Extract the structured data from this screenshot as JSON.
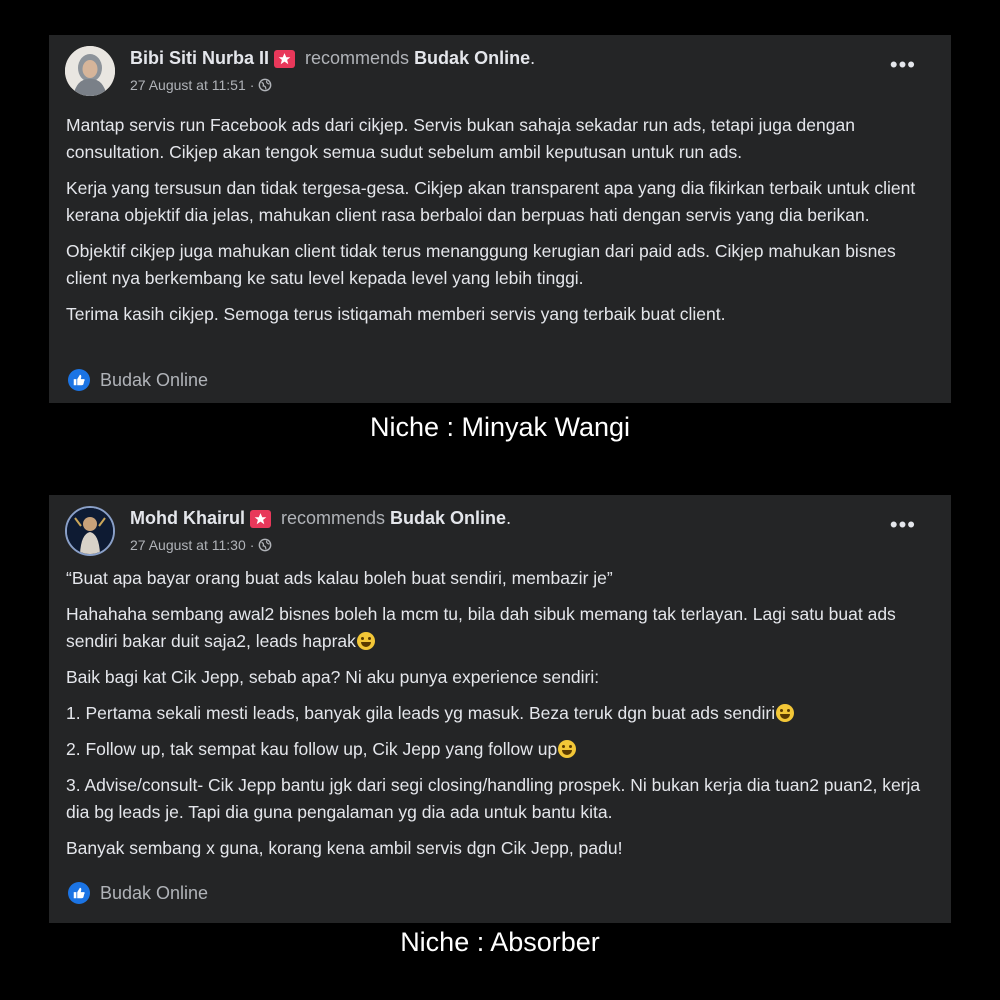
{
  "posts": [
    {
      "author": "Bibi Siti Nurba II",
      "action": "recommends",
      "page": "Budak Online",
      "date": "27 August at 11:51",
      "paragraphs": [
        "Mantap servis run Facebook ads dari cikjep. Servis bukan sahaja sekadar run ads, tetapi juga dengan consultation. Cikjep akan tengok semua sudut sebelum ambil keputusan untuk run ads.",
        "Kerja yang tersusun dan tidak tergesa-gesa. Cikjep akan transparent apa yang dia fikirkan terbaik untuk client kerana objektif dia jelas, mahukan client rasa berbaloi dan berpuas hati dengan servis yang dia berikan.",
        "Objektif cikjep juga mahukan client tidak terus menanggung kerugian dari paid ads. Cikjep mahukan bisnes client nya berkembang ke satu level kepada level yang lebih tinggi.",
        "Terima kasih cikjep. Semoga terus istiqamah memberi servis yang terbaik buat client."
      ],
      "footer_page": "Budak Online",
      "caption": "Niche : Minyak Wangi"
    },
    {
      "author": "Mohd Khairul",
      "action": "recommends",
      "page": "Budak Online",
      "date": "27 August at 11:30",
      "paragraphs": [
        "“Buat apa bayar orang buat ads kalau boleh buat sendiri, membazir je”",
        "Hahahaha sembang awal2 bisnes boleh la mcm tu, bila dah sibuk memang tak terlayan. Lagi satu buat ads sendiri bakar duit saja2, leads haprak",
        "Baik bagi kat Cik Jepp, sebab apa? Ni aku punya experience sendiri:",
        "1. Pertama sekali mesti leads, banyak gila leads yg masuk. Beza teruk dgn buat ads sendiri",
        "2. Follow up, tak sempat kau follow up, Cik Jepp yang follow up",
        "3. Advise/consult- Cik Jepp bantu jgk dari segi closing/handling prospek. Ni bukan kerja dia tuan2 puan2, kerja dia bg leads je. Tapi dia guna pengalaman yg dia ada untuk bantu kita.",
        "Banyak sembang x guna, korang kena ambil servis dgn Cik Jepp, padu!"
      ],
      "footer_page": "Budak Online",
      "caption": "Niche : Absorber"
    }
  ],
  "icons": {
    "badge": "star-badge-icon",
    "privacy": "globe-icon",
    "more": "more-options-icon",
    "recommend": "thumbs-up-icon",
    "emoji": "grinning-face-emoji"
  },
  "colors": {
    "card_bg": "#242526",
    "badge": "#e8385a",
    "like": "#1b74e4"
  }
}
